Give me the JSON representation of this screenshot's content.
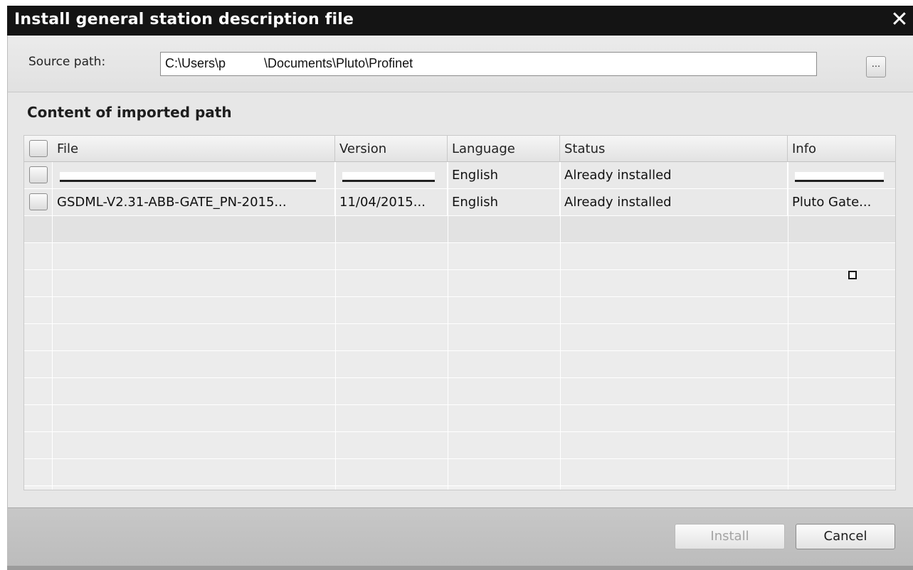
{
  "window": {
    "title": "Install general station description file",
    "close_glyph": "✕"
  },
  "source": {
    "label": "Source path:",
    "value": "C:\\Users\\p      \\Documents\\Pluto\\Profinet",
    "browse_label": "..."
  },
  "section": {
    "title": "Content of imported path"
  },
  "table": {
    "columns": [
      "File",
      "Version",
      "Language",
      "Status",
      "Info"
    ],
    "rows": [
      {
        "file": "",
        "version": "",
        "language": "English",
        "status": "Already installed",
        "info": ""
      },
      {
        "file": "GSDML-V2.31-ABB-GATE_PN-2015...",
        "version": "11/04/2015...",
        "language": "English",
        "status": "Already installed",
        "info": "Pluto Gate..."
      }
    ]
  },
  "footer": {
    "install_label": "Install",
    "cancel_label": "Cancel"
  },
  "icons": {
    "close": "close-icon",
    "browse": "ellipsis-icon",
    "checkbox": "checkbox-icon"
  }
}
